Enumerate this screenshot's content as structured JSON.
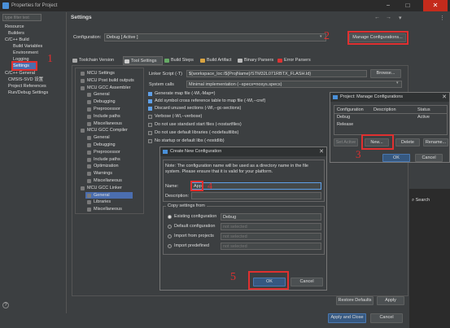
{
  "window": {
    "title": "Properties for Project",
    "min": "−",
    "max": "□",
    "close": "✕"
  },
  "sidebar": {
    "filter_placeholder": "type filter text",
    "items": [
      "Resource",
      "Builders",
      "C/C++ Build",
      "Build Variables",
      "Environment",
      "Logging",
      "Settings",
      "C/C++ General",
      "CMSIS-SVD 设置",
      "Project References",
      "Run/Debug Settings"
    ]
  },
  "header": {
    "title": "Settings",
    "nav": [
      "←",
      "→",
      "▾",
      "⋮"
    ]
  },
  "configuration": {
    "label": "Configuration:",
    "value": "Debug  [ Active ]",
    "manage_button": "Manage Configurations..."
  },
  "tabs": [
    "Toolchain Version",
    "Tool Settings",
    "Build Steps",
    "Build Artifact",
    "Binary Parsers",
    "Error Parsers"
  ],
  "tool_tree": [
    "MCU Settings",
    "MCU Post build outputs",
    "MCU GCC Assembler",
    "General",
    "Debugging",
    "Preprocessor",
    "Include paths",
    "Miscellaneous",
    "MCU GCC Compiler",
    "General",
    "Debugging",
    "Preprocessor",
    "Include paths",
    "Optimization",
    "Warnings",
    "Miscellaneous",
    "MCU GCC Linker",
    "General",
    "Libraries",
    "Miscellaneous"
  ],
  "linker": {
    "script_label": "Linker Script (-T)",
    "script_value": "${workspace_loc:/${ProjName}/STM32L071RBTX_FLASH.ld}",
    "browse": "Browse...",
    "syscalls_label": "System calls",
    "syscalls_value": "Minimal implementation (--specs=nosys.specs)",
    "options": [
      {
        "label": "Generate map file (-Wl,-Map=)",
        "checked": true
      },
      {
        "label": "Add symbol cross reference table to map file (-Wl,--cref)",
        "checked": true
      },
      {
        "label": "Discard unused sections (-Wl,--gc-sections)",
        "checked": true
      },
      {
        "label": "Verbose (-Wl,--verbose)",
        "checked": false
      },
      {
        "label": "Do not use standard start files (-nostartfiles)",
        "checked": false
      },
      {
        "label": "Do not use default libraries (-nodefaultlibs)",
        "checked": false
      },
      {
        "label": "No startup or default libs (-nostdlib)",
        "checked": false
      }
    ]
  },
  "manage_dialog": {
    "title": "Project: Manage Configurations",
    "columns": [
      "Configuration",
      "Description",
      "Status"
    ],
    "rows": [
      [
        "Debug",
        "",
        "Active"
      ],
      [
        "Release",
        "",
        ""
      ]
    ],
    "set_active": "Set Active",
    "new": "New...",
    "delete": "Delete",
    "rename": "Rename...",
    "ok": "OK",
    "cancel": "Cancel"
  },
  "create_dialog": {
    "title": "Create New Configuration",
    "note": "Note: The configuration name will be used as a directory name in the file system.  Please ensure that it is valid for your platform.",
    "name_label": "Name:",
    "name_value": "App",
    "desc_label": "Description:",
    "copy_group": "Copy settings from",
    "options": [
      {
        "label": "Existing configuration",
        "value": "Debug",
        "selected": true
      },
      {
        "label": "Default configuration",
        "value": "not selected",
        "selected": false
      },
      {
        "label": "Import from projects",
        "value": "not selected",
        "selected": false
      },
      {
        "label": "Import predefined",
        "value": "not selected",
        "selected": false
      }
    ],
    "ok": "OK",
    "cancel": "Cancel"
  },
  "footer": {
    "restore": "Restore Defaults",
    "apply": "Apply",
    "apply_close": "Apply and Close",
    "cancel": "Cancel",
    "help": "?"
  },
  "side_panel": {
    "search": "Search"
  },
  "annotations": [
    "1",
    "2",
    "3",
    "4",
    "5"
  ]
}
